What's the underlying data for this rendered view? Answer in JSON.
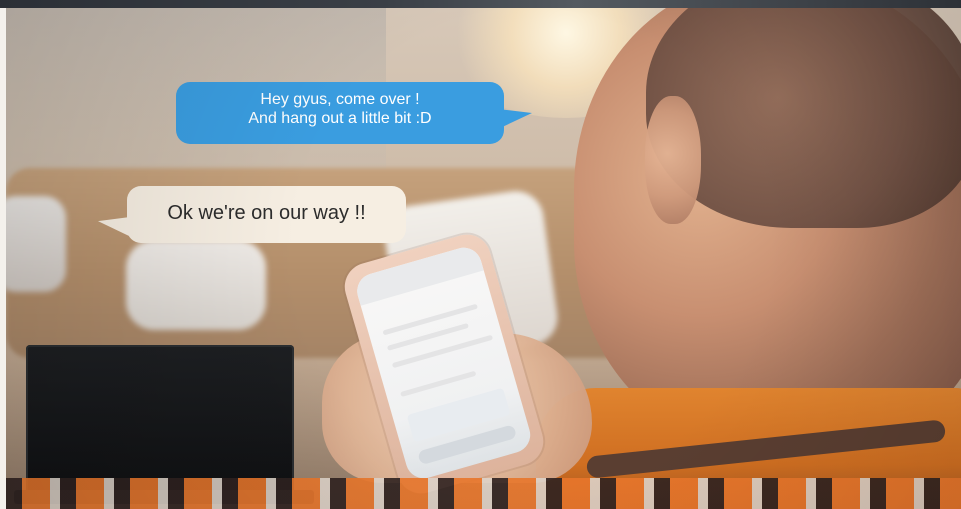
{
  "scene": {
    "messages": [
      {
        "lines": [
          "Hey gyus, come over !",
          "And hang out a little bit :D"
        ],
        "bubble_color": "#3a9de0",
        "text_color": "#ffffff"
      },
      {
        "lines": [
          "Ok we're on our way !!"
        ],
        "bubble_color": "#f6eee2",
        "text_color": "#2c2c2c"
      }
    ]
  }
}
